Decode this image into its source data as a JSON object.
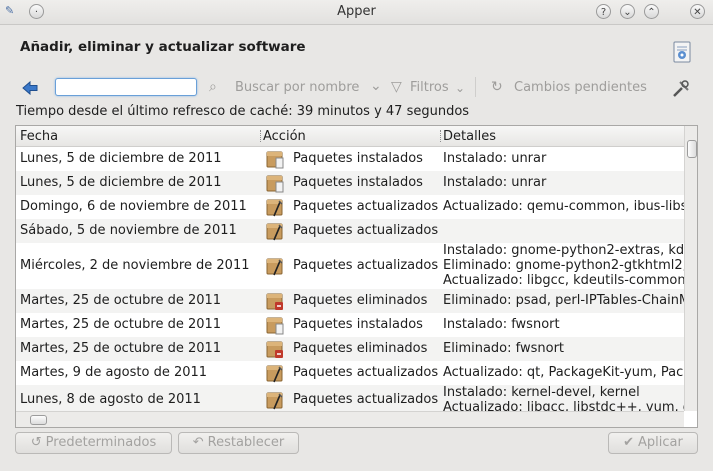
{
  "window": {
    "title": "Apper"
  },
  "header": {
    "title": "Añadir, eliminar y actualizar software"
  },
  "toolbar": {
    "search_value": "",
    "search_by_name": "Buscar por nombre",
    "filters": "Filtros",
    "pending_changes": "Cambios pendientes"
  },
  "cache_info": "Tiempo desde el último refresco de caché: 39 minutos y 47 segundos",
  "table": {
    "columns": [
      "Fecha",
      "Acción",
      "Detalles"
    ],
    "rows": [
      {
        "date": "Lunes, 5 de diciembre de 2011",
        "action": "Paquetes instalados",
        "icon": "package-installed-icon",
        "details": [
          "Instalado: unrar"
        ]
      },
      {
        "date": "Lunes, 5 de diciembre de 2011",
        "action": "Paquetes instalados",
        "icon": "package-installed-icon",
        "details": [
          "Instalado: unrar"
        ]
      },
      {
        "date": "Domingo, 6 de noviembre de 2011",
        "action": "Paquetes actualizados",
        "icon": "package-updated-icon",
        "details": [
          "Actualizado: qemu-common, ibus-libs"
        ]
      },
      {
        "date": "Sábado, 5 de noviembre de 2011",
        "action": "Paquetes actualizados",
        "icon": "package-updated-icon",
        "details": []
      },
      {
        "date": "Miércoles, 2 de noviembre de 2011",
        "action": "Paquetes actualizados",
        "icon": "package-updated-icon",
        "details": [
          "Instalado: gnome-python2-extras, kde",
          "Eliminado: gnome-python2-gtkhtml2,",
          "Actualizado: libgcc, kdeutils-common"
        ]
      },
      {
        "date": "Martes, 25 de octubre de 2011",
        "action": "Paquetes eliminados",
        "icon": "package-removed-icon",
        "details": [
          "Eliminado: psad, perl-IPTables-ChainM"
        ]
      },
      {
        "date": "Martes, 25 de octubre de 2011",
        "action": "Paquetes instalados",
        "icon": "package-installed-icon",
        "details": [
          "Instalado: fwsnort"
        ]
      },
      {
        "date": "Martes, 25 de octubre de 2011",
        "action": "Paquetes eliminados",
        "icon": "package-removed-icon",
        "details": [
          "Eliminado: fwsnort"
        ]
      },
      {
        "date": "Martes, 9 de agosto de 2011",
        "action": "Paquetes actualizados",
        "icon": "package-updated-icon",
        "details": [
          "Actualizado: qt, PackageKit-yum, Pack"
        ]
      },
      {
        "date": "Lunes, 8 de agosto de 2011",
        "action": "Paquetes actualizados",
        "icon": "package-updated-icon",
        "details": [
          "Instalado: kernel-devel, kernel",
          "Actualizado: libgcc, libstdc++, yum, d"
        ]
      }
    ]
  },
  "buttons": {
    "defaults": "Predeterminados",
    "reset": "Restablecer",
    "apply": "Aplicar"
  },
  "colors": {
    "selection_blue": "#6aa0d8",
    "disabled_text": "#a3a2a0",
    "removed_badge": "#c0392b"
  }
}
